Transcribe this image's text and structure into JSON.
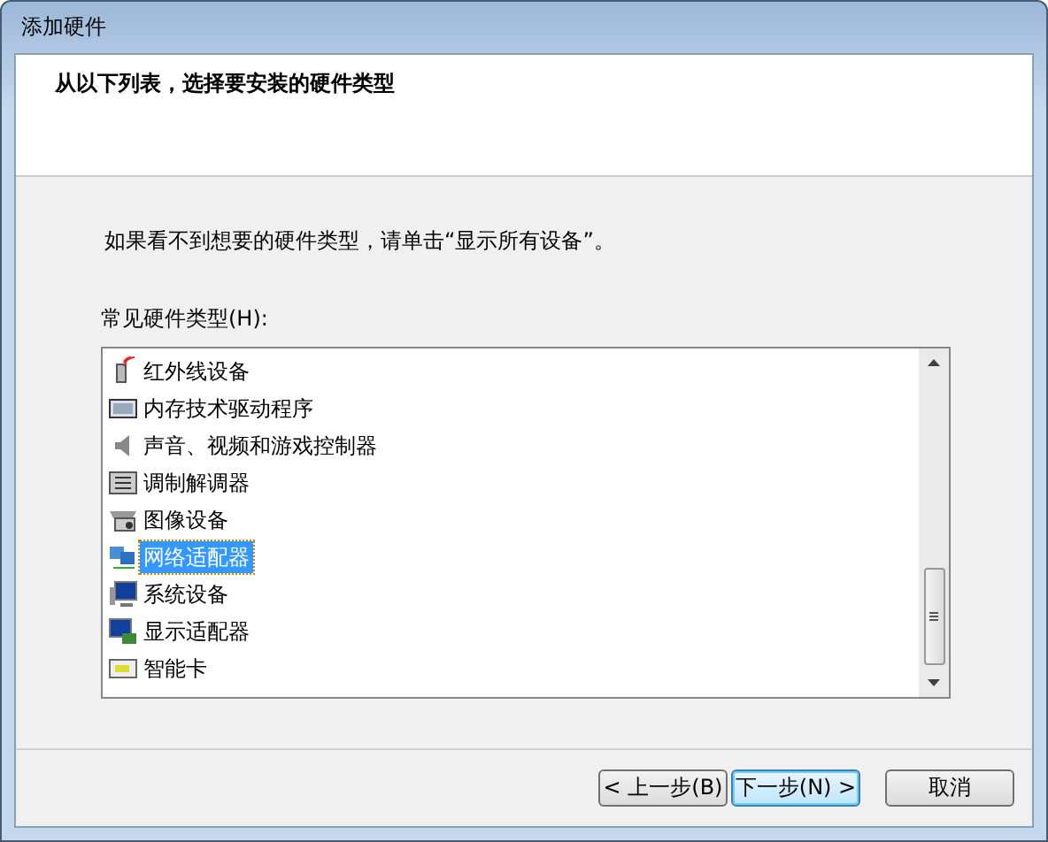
{
  "window": {
    "title": "添加硬件"
  },
  "header": {
    "title": "从以下列表，选择要安装的硬件类型"
  },
  "instruction": "如果看不到想要的硬件类型，请单击“显示所有设备”。",
  "list": {
    "label": "常见硬件类型(H):",
    "items": [
      {
        "label": "红外线设备",
        "selected": false
      },
      {
        "label": "内存技术驱动程序",
        "selected": false
      },
      {
        "label": "声音、视频和游戏控制器",
        "selected": false
      },
      {
        "label": "调制解调器",
        "selected": false
      },
      {
        "label": "图像设备",
        "selected": false
      },
      {
        "label": "网络适配器",
        "selected": true
      },
      {
        "label": "系统设备",
        "selected": false
      },
      {
        "label": "显示适配器",
        "selected": false
      },
      {
        "label": "智能卡",
        "selected": false
      }
    ]
  },
  "buttons": [
    {
      "label": "< 上一步(B)",
      "kind": "normal"
    },
    {
      "label": "下一步(N) >",
      "kind": "default"
    },
    {
      "label": "取消",
      "kind": "normal"
    }
  ]
}
